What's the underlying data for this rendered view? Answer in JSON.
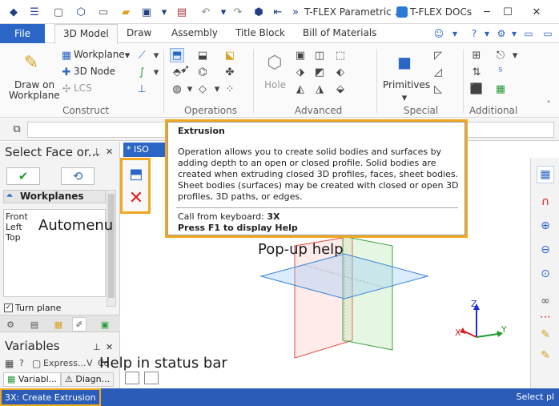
{
  "window": {
    "title": "T-FLEX Parametric ...",
    "docs_app": "T-FLEX DOCs"
  },
  "ribbon_tabs": [
    {
      "label": "File"
    },
    {
      "label": "3D Model"
    },
    {
      "label": "Draw"
    },
    {
      "label": "Assembly"
    },
    {
      "label": "Title Block"
    },
    {
      "label": "Bill of Materials"
    }
  ],
  "ribbon": {
    "construct": {
      "draw_on_workplane_l1": "Draw on",
      "draw_on_workplane_l2": "Workplane",
      "workplane": "Workplane",
      "node": "3D Node",
      "lcs": "LCS",
      "group": "Construct"
    },
    "operations": {
      "group": "Operations"
    },
    "advanced": {
      "hole": "Hole",
      "group": "Advanced"
    },
    "special": {
      "primitives": "Primitives",
      "group": "Special"
    },
    "additional": {
      "group": "Additional"
    }
  },
  "left_panel": {
    "title": "Select Face or...",
    "workplanes_header": "Workplanes",
    "workplanes": [
      "Front",
      "Left",
      "Top"
    ],
    "turn_plane": "Turn plane",
    "variables_title": "Variables",
    "variables_toolbar": [
      "?",
      "Express...",
      "V",
      "Co"
    ],
    "bottom_tabs": [
      "Variabl...",
      "Diagn..."
    ]
  },
  "document_tab": {
    "label": "* ISO"
  },
  "tooltip": {
    "title": "Extrusion",
    "body": "Operation allows you to create solid bodies and surfaces by adding depth to an open or closed profile.  Solid bodies are created when extruding closed 3D profiles, faces, sheet bodies. Sheet bodies (surfaces) may be created with closed or open 3D profiles, 3D paths, or edges.",
    "keyboard_label": "Call from keyboard:",
    "keyboard_value": "3X",
    "f1_help": "Press F1 to display Help"
  },
  "callouts": {
    "automenu": "Automenu",
    "popup": "Pop-up help",
    "status": "Help in status bar"
  },
  "axes": {
    "x": "X",
    "y": "Y",
    "z": "Z"
  },
  "status_bar": {
    "left": "3X: Create Extrusion",
    "right": "Select pl"
  },
  "colors": {
    "accent": "#2b66c6",
    "highlight": "#f0a820",
    "status_bg": "#2b5db8"
  }
}
